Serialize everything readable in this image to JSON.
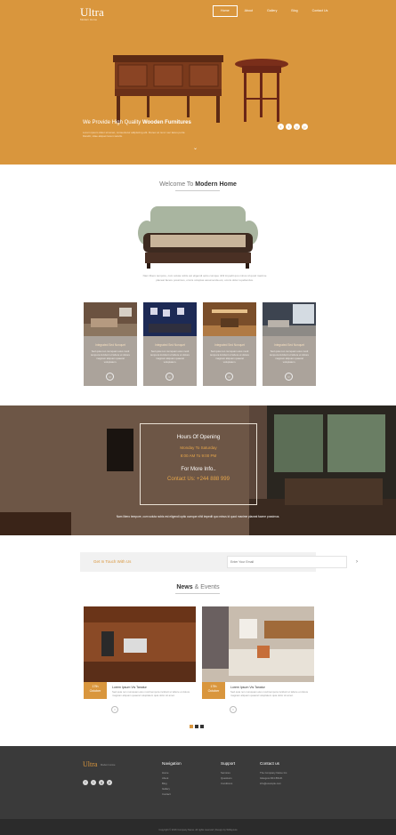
{
  "brand": {
    "name": "Ultra",
    "tagline": "Modern Home"
  },
  "nav": {
    "items": [
      "Home",
      "About",
      "Gallery",
      "Blog",
      "Contact Us"
    ],
    "active": 0
  },
  "hero": {
    "title_prefix": "We Provide ",
    "title_mid": "High Quality ",
    "title_bold": "Wooden Furnitures",
    "text": "Lorem ipsum dolor sit amet, consectetur adipiscing elit. Donec at nunc nec lacus porta blandit, vitae aliquet lorem iaculis.",
    "social": [
      "f",
      "t",
      "g",
      "p"
    ],
    "arrow": "⌄"
  },
  "welcome": {
    "title_prefix": "Welcome To ",
    "title_bold": "Modern Home",
    "text": "Nam libero tempore, cum soluta nobis est eligendi optio cumque nihil impedit quo minus id quod maxime placeat facere possimus, omnis voluptas assumenda est, omnis dolor repellendus."
  },
  "cards": [
    {
      "title": "Integrated Sed Nonquet",
      "text": "Sed quia non numquam eius modi tempora incidunt ut labore et dolore magnam aliquam quaerat voluptatem.",
      "icon": "○"
    },
    {
      "title": "Integrated Sed Nonquet",
      "text": "Sed quia non numquam eius modi tempora incidunt ut labore et dolore magnam aliquam quaerat voluptatem.",
      "icon": "○"
    },
    {
      "title": "Integrated Sed Nonquet",
      "text": "Sed quia non numquam eius modi tempora incidunt ut labore et dolore magnam aliquam quaerat voluptatem.",
      "icon": "○"
    },
    {
      "title": "Integrated Sed Nonquet",
      "text": "Sed quia non numquam eius modi tempora incidunt ut labore et dolore magnam aliquam quaerat voluptatem.",
      "icon": "○"
    }
  ],
  "hours": {
    "title": "Hours Of Opening",
    "days": "Monday To Saturday",
    "time": "8:00 AM To 9:00 PM",
    "more_title": "For More Info..",
    "contact": "Contact Us: +244 888 999",
    "band_text": "Nam libero tempore, cum soluta nobis est eligendi optio cumque nihil impedit quo minus id quod maxime placeat facere possimus."
  },
  "subscribe": {
    "label": "Get In Touch With Us",
    "placeholder": "Enter Your Email",
    "button": "›"
  },
  "news": {
    "title_bold": "News",
    "title_rest": " & Events",
    "items": [
      {
        "date_day": "17th",
        "date_month": "October",
        "title": "Lorem Ipsum Vis Tanatur",
        "text": "Sed quia non numquam eius modi tempora incidunt ut labore et dolore magnam aliquam quaerat voluptatem quia dolor sit amet.",
        "icon": "○"
      },
      {
        "date_day": "17th",
        "date_month": "October",
        "title": "Lorem Ipsum Vis Tanatur",
        "text": "Sed quia non numquam eius modi tempora incidunt ut labore et dolore magnam aliquam quaerat voluptatem quia dolor sit amet.",
        "icon": "○"
      }
    ]
  },
  "footer": {
    "logo": "Ultra",
    "logo_sub": "Modern Home",
    "social": [
      "f",
      "t",
      "g",
      "p"
    ],
    "columns": [
      {
        "title": "Navigation",
        "items": [
          "Home",
          "About",
          "Blog",
          "Gallery",
          "Contact"
        ]
      },
      {
        "title": "Support",
        "items": [
          "Services",
          "Questions",
          "Conditions"
        ]
      },
      {
        "title": "Contact us",
        "items": [
          "The Company Name Inc.",
          "Glasgow D04 89GR.",
          "info@example.com"
        ]
      }
    ],
    "copyright": "Copyright © 2016 Company Name. All rights reserved | Design by W3layouts"
  }
}
